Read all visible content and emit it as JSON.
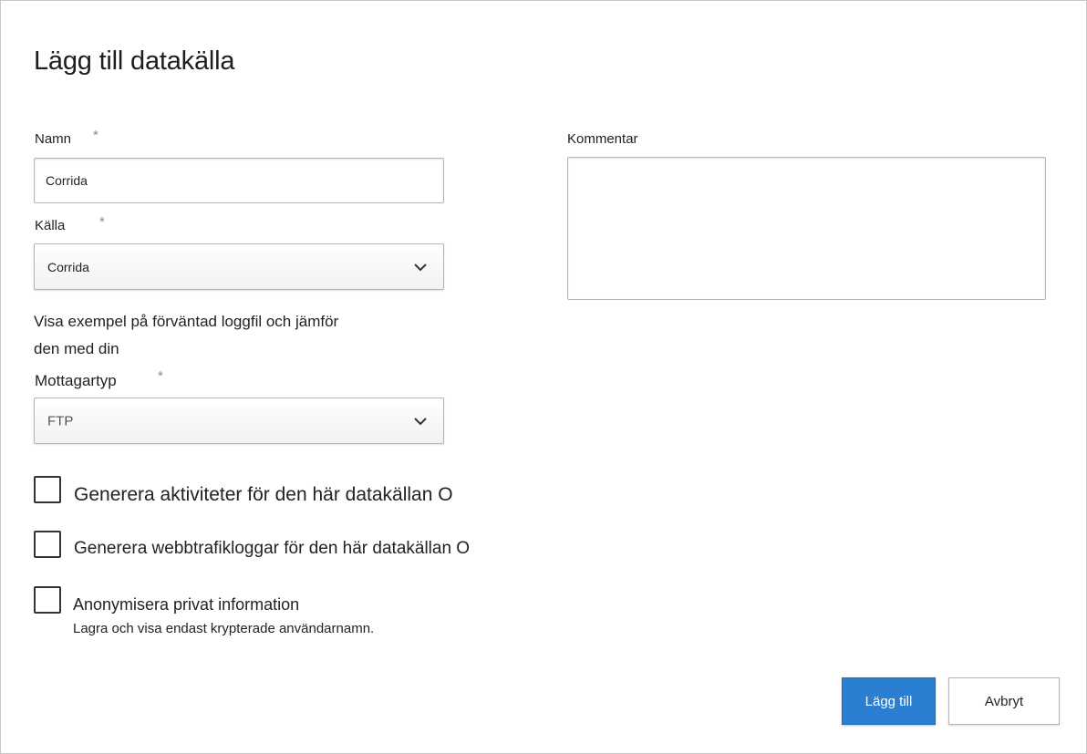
{
  "dialog": {
    "title": "Lägg till datakälla"
  },
  "form": {
    "name": {
      "label": "Namn",
      "required_mark": "*",
      "value": "Corrida"
    },
    "source": {
      "label": "Källa",
      "required_mark": "*",
      "selected": "Corrida"
    },
    "description": {
      "line1": "Visa exempel på förväntad loggfil och jämför",
      "line2": "den med din"
    },
    "receiver_type": {
      "label": "Mottagartyp",
      "required_mark": "*",
      "selected": "FTP"
    },
    "comment": {
      "label": "Kommentar",
      "value": ""
    },
    "checkboxes": [
      {
        "label": "Generera aktiviteter för den här datakällan O",
        "checked": false
      },
      {
        "label": "Generera webbtrafikloggar för den här datakällan O",
        "checked": false
      },
      {
        "label": "Anonymisera privat information",
        "sublabel": "Lagra och visa endast krypterade användarnamn.",
        "checked": false
      }
    ]
  },
  "buttons": {
    "add": "Lägg till",
    "cancel": "Avbryt"
  },
  "colors": {
    "primary": "#2a7fd2",
    "border": "#b5b5b5",
    "text": "#222222"
  }
}
